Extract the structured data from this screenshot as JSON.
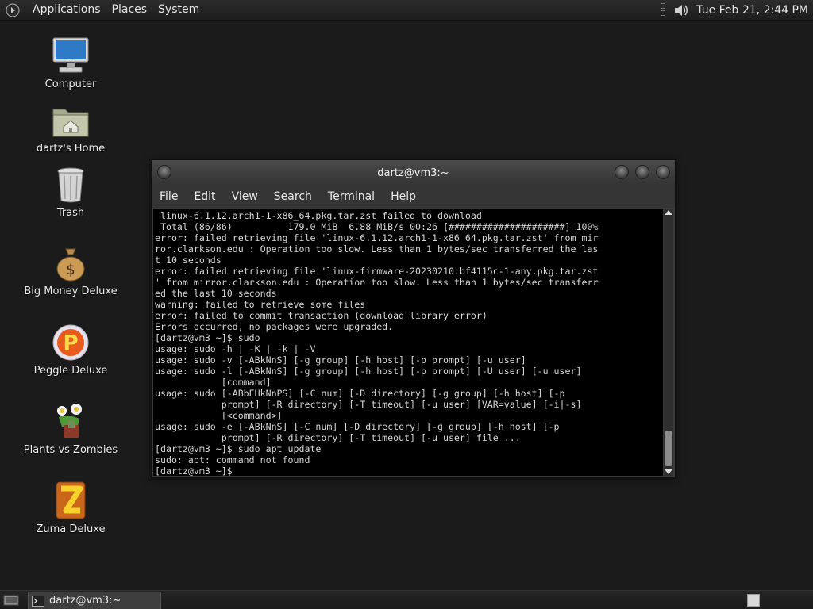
{
  "top_panel": {
    "menus": [
      "Applications",
      "Places",
      "System"
    ],
    "clock": "Tue Feb 21,  2:44 PM"
  },
  "desktop_icons": [
    {
      "label": "Computer",
      "icon": "computer-icon"
    },
    {
      "label": "dartz's Home",
      "icon": "home-folder-icon"
    },
    {
      "label": "Trash",
      "icon": "trash-icon"
    },
    {
      "label": "Big Money Deluxe",
      "icon": "money-bag-icon"
    },
    {
      "label": "Peggle Deluxe",
      "icon": "peggle-icon"
    },
    {
      "label": "Plants vs Zombies",
      "icon": "plants-vs-zombies-icon"
    },
    {
      "label": "Zuma Deluxe",
      "icon": "zuma-icon"
    }
  ],
  "terminal": {
    "title": "dartz@vm3:~",
    "menu": [
      "File",
      "Edit",
      "View",
      "Search",
      "Terminal",
      "Help"
    ],
    "lines": [
      " linux-6.1.12.arch1-1-x86_64.pkg.tar.zst failed to download",
      " Total (86/86)          179.0 MiB  6.88 MiB/s 00:26 [#####################] 100%",
      "error: failed retrieving file 'linux-6.1.12.arch1-1-x86_64.pkg.tar.zst' from mir",
      "ror.clarkson.edu : Operation too slow. Less than 1 bytes/sec transferred the las",
      "t 10 seconds",
      "error: failed retrieving file 'linux-firmware-20230210.bf4115c-1-any.pkg.tar.zst",
      "' from mirror.clarkson.edu : Operation too slow. Less than 1 bytes/sec transferr",
      "ed the last 10 seconds",
      "warning: failed to retrieve some files",
      "error: failed to commit transaction (download library error)",
      "Errors occurred, no packages were upgraded.",
      "[dartz@vm3 ~]$ sudo",
      "usage: sudo -h | -K | -k | -V",
      "usage: sudo -v [-ABkNnS] [-g group] [-h host] [-p prompt] [-u user]",
      "usage: sudo -l [-ABkNnS] [-g group] [-h host] [-p prompt] [-U user] [-u user]",
      "            [command]",
      "usage: sudo [-ABbEHkNnPS] [-C num] [-D directory] [-g group] [-h host] [-p",
      "            prompt] [-R directory] [-T timeout] [-u user] [VAR=value] [-i|-s]",
      "            [<command>]",
      "usage: sudo -e [-ABkNnS] [-C num] [-D directory] [-g group] [-h host] [-p",
      "            prompt] [-R directory] [-T timeout] [-u user] file ...",
      "[dartz@vm3 ~]$ sudo apt update",
      "sudo: apt: command not found",
      "[dartz@vm3 ~]$ "
    ]
  },
  "taskbar": {
    "window_label": "dartz@vm3:~"
  }
}
